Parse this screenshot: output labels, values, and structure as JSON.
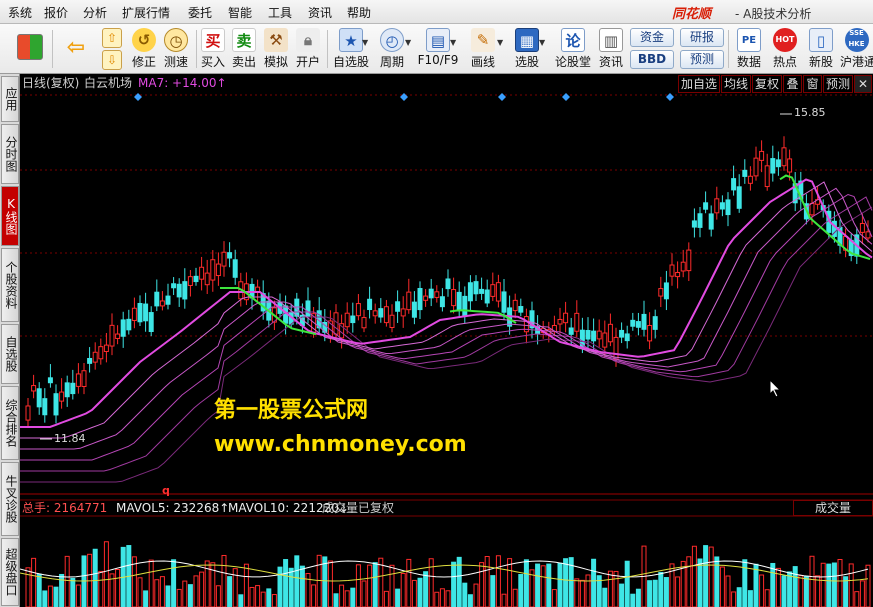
{
  "menu": [
    "系统",
    "报价",
    "分析",
    "扩展行情",
    "委托",
    "智能",
    "工具",
    "资讯",
    "帮助"
  ],
  "brand": "同花顺",
  "app_subtitle": "- A股技术分析",
  "toolbar": {
    "items": [
      {
        "label": "修正",
        "icon": "clock-undo-icon"
      },
      {
        "label": "测速",
        "icon": "clock-speed-icon"
      },
      {
        "label": "买入",
        "icon": "buy-icon",
        "glyph": "买"
      },
      {
        "label": "卖出",
        "icon": "sell-icon",
        "glyph": "卖"
      },
      {
        "label": "模拟",
        "icon": "hammer-icon"
      },
      {
        "label": "开户",
        "icon": "lock-icon"
      },
      {
        "label": "自选股",
        "icon": "star-folder-icon"
      },
      {
        "label": "周期",
        "icon": "cycle-clock-icon"
      },
      {
        "label": "F10/F9",
        "icon": "document-icon"
      },
      {
        "label": "画线",
        "icon": "pen-icon"
      },
      {
        "label": "选股",
        "icon": "screen-chart-icon"
      },
      {
        "label": "论股堂",
        "icon": "forum-icon",
        "glyph": "论"
      },
      {
        "label": "资讯",
        "icon": "news-icon"
      },
      {
        "label": "数据",
        "icon": "pe-data-icon"
      },
      {
        "label": "热点",
        "icon": "hot-spot-icon"
      },
      {
        "label": "新股",
        "icon": "new-stock-icon"
      },
      {
        "label": "沪港通",
        "icon": "hk-connect-icon"
      }
    ],
    "buttons": {
      "funds": "资金",
      "research": "研报",
      "bbd": "BBD",
      "forecast": "预测"
    }
  },
  "side_tabs": [
    "应用",
    "分时图",
    "K线图",
    "个股资料",
    "自选股",
    "综合排名",
    "牛叉诊股",
    "超级盘口"
  ],
  "chart_header": {
    "period": "日线(复权)",
    "stock_name": "白云机场",
    "ma_label": "MA7: +14.00↑"
  },
  "chart_buttons": [
    "加自选",
    "均线",
    "复权",
    "叠",
    "窗",
    "预测"
  ],
  "annotations": {
    "high": "15.85",
    "low": "11.84",
    "marker": "q"
  },
  "watermark": {
    "line1": "第一股票公式网",
    "line2": "www.chnmoney.com"
  },
  "volume_header": {
    "total": "总手: 2164771",
    "mavol5": "MAVOL5: 232268↑",
    "mavol10": "MAVOL10: 221220↓",
    "note": "成交量已复权",
    "button": "成交量"
  },
  "colors": {
    "up": "#ff2b2b",
    "down": "#3ee6e6",
    "ma_main": "#e14be1",
    "ma_top": "#3ee63e",
    "watermark": "#ffe000"
  },
  "chart_data": {
    "type": "candlestick",
    "stock": "白云机场",
    "period": "日线(复权)",
    "y_range": [
      11.84,
      15.85
    ],
    "marked_high": 15.85,
    "marked_low": 11.84,
    "ma7": 14.0
  }
}
